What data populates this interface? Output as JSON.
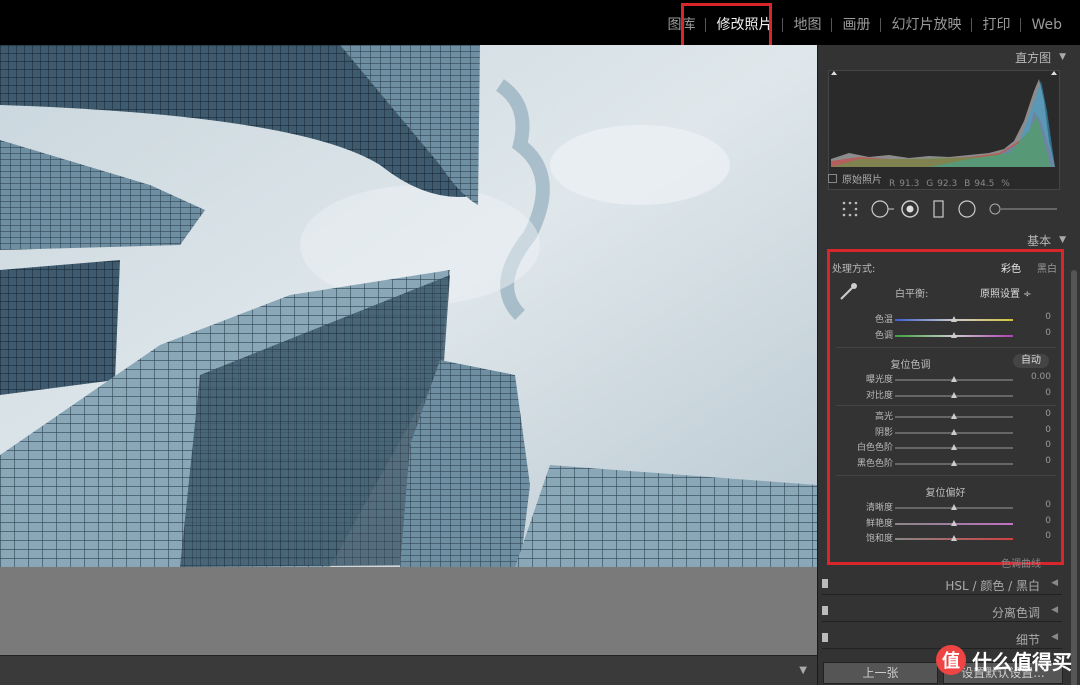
{
  "modules": [
    "图库",
    "修改照片",
    "地图",
    "画册",
    "幻灯片放映",
    "打印",
    "Web"
  ],
  "active_module": "修改照片",
  "histogram": {
    "title": "直方图",
    "r_label": "R",
    "r_val": "91.3",
    "g_label": "G",
    "g_val": "92.3",
    "b_label": "B",
    "b_val": "94.5",
    "unit": "%",
    "original_photo": "原始照片"
  },
  "basic": {
    "title": "基本",
    "treatment_label": "处理方式:",
    "treatment_color": "彩色",
    "treatment_bw": "黑白",
    "wb_label": "白平衡:",
    "wb_value": "原照设置 ÷",
    "tone_reset": "复位色调",
    "auto_label": "自动",
    "presence_reset": "复位偏好",
    "next_section": "色调曲线"
  },
  "sliders_wb": [
    {
      "label": "色温",
      "value": "0",
      "pos": 0.5,
      "track": "temp"
    },
    {
      "label": "色调",
      "value": "0",
      "pos": 0.5,
      "track": "tint"
    }
  ],
  "sliders_tone1": [
    {
      "label": "曝光度",
      "value": "0.00",
      "pos": 0.5
    },
    {
      "label": "对比度",
      "value": "0",
      "pos": 0.5
    }
  ],
  "sliders_tone2": [
    {
      "label": "高光",
      "value": "0",
      "pos": 0.5
    },
    {
      "label": "阴影",
      "value": "0",
      "pos": 0.5
    },
    {
      "label": "白色色阶",
      "value": "0",
      "pos": 0.5
    },
    {
      "label": "黑色色阶",
      "value": "0",
      "pos": 0.5
    }
  ],
  "sliders_presence": [
    {
      "label": "清晰度",
      "value": "0",
      "pos": 0.5
    },
    {
      "label": "鲜艳度",
      "value": "0",
      "pos": 0.5,
      "track": "vib"
    },
    {
      "label": "饱和度",
      "value": "0",
      "pos": 0.5,
      "track": "sat"
    }
  ],
  "panels": {
    "hsl": "HSL / 颜色 / 黑白",
    "split": "分离色调",
    "detail": "细节"
  },
  "buttons": {
    "previous": "上一张",
    "reset": "设置默认设置..."
  },
  "watermark": "什么值得买",
  "watermark_icon_char": "值",
  "colors": {
    "highlight": "#d9262c"
  }
}
